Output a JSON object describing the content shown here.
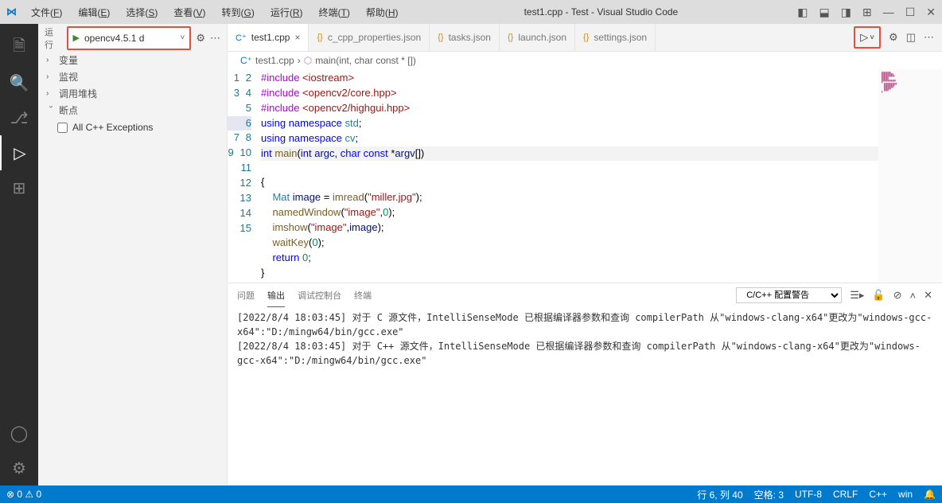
{
  "titlebar": {
    "menus": [
      {
        "label": "文件",
        "u": "F"
      },
      {
        "label": "编辑",
        "u": "E"
      },
      {
        "label": "选择",
        "u": "S"
      },
      {
        "label": "查看",
        "u": "V"
      },
      {
        "label": "转到",
        "u": "G"
      },
      {
        "label": "运行",
        "u": "R"
      },
      {
        "label": "终端",
        "u": "T"
      },
      {
        "label": "帮助",
        "u": "H"
      }
    ],
    "title": "test1.cpp - Test - Visual Studio Code"
  },
  "sidebar": {
    "run_label": "运行",
    "config_name": "opencv4.5.1 d",
    "sections": [
      {
        "label": "变量",
        "expanded": false
      },
      {
        "label": "监视",
        "expanded": false
      },
      {
        "label": "调用堆栈",
        "expanded": false
      },
      {
        "label": "断点",
        "expanded": true,
        "children": [
          {
            "label": "All C++ Exceptions",
            "checked": false
          }
        ]
      }
    ]
  },
  "tabs": [
    {
      "label": "test1.cpp",
      "icon": "cpp",
      "active": true,
      "closable": true
    },
    {
      "label": "c_cpp_properties.json",
      "icon": "json"
    },
    {
      "label": "tasks.json",
      "icon": "json"
    },
    {
      "label": "launch.json",
      "icon": "json"
    },
    {
      "label": "settings.json",
      "icon": "json"
    }
  ],
  "breadcrumb": {
    "file": "test1.cpp",
    "symbol": "main(int, char const * [])"
  },
  "code": {
    "lines": 15,
    "highlight_line": 6,
    "raw": [
      [
        {
          "t": "#include ",
          "c": "pre"
        },
        {
          "t": "<iostream>",
          "c": "inc"
        }
      ],
      [
        {
          "t": "#include ",
          "c": "pre"
        },
        {
          "t": "<opencv2/core.hpp>",
          "c": "inc"
        }
      ],
      [
        {
          "t": "#include ",
          "c": "pre"
        },
        {
          "t": "<opencv2/highgui.hpp>",
          "c": "inc"
        }
      ],
      [
        {
          "t": "using namespace ",
          "c": "kw"
        },
        {
          "t": "std",
          "c": "type"
        },
        {
          "t": ";",
          "c": ""
        }
      ],
      [
        {
          "t": "using namespace ",
          "c": "kw"
        },
        {
          "t": "cv",
          "c": "type"
        },
        {
          "t": ";",
          "c": ""
        }
      ],
      [
        {
          "t": "int ",
          "c": "kw"
        },
        {
          "t": "main",
          "c": "fn"
        },
        {
          "t": "(",
          "c": ""
        },
        {
          "t": "int ",
          "c": "kw"
        },
        {
          "t": "argc",
          "c": "var"
        },
        {
          "t": ", ",
          "c": ""
        },
        {
          "t": "char const ",
          "c": "kw"
        },
        {
          "t": "*",
          "c": ""
        },
        {
          "t": "argv",
          "c": "var"
        },
        {
          "t": "[])",
          "c": ""
        }
      ],
      [
        {
          "t": "{",
          "c": ""
        }
      ],
      [
        {
          "t": "    ",
          "c": ""
        },
        {
          "t": "Mat ",
          "c": "type"
        },
        {
          "t": "image",
          "c": "var"
        },
        {
          "t": " = ",
          "c": ""
        },
        {
          "t": "imread",
          "c": "fn"
        },
        {
          "t": "(",
          "c": ""
        },
        {
          "t": "\"miller.jpg\"",
          "c": "str"
        },
        {
          "t": ");",
          "c": ""
        }
      ],
      [
        {
          "t": "    ",
          "c": ""
        },
        {
          "t": "namedWindow",
          "c": "fn"
        },
        {
          "t": "(",
          "c": ""
        },
        {
          "t": "\"image\"",
          "c": "str"
        },
        {
          "t": ",",
          "c": ""
        },
        {
          "t": "0",
          "c": "num"
        },
        {
          "t": ");",
          "c": ""
        }
      ],
      [
        {
          "t": "    ",
          "c": ""
        },
        {
          "t": "imshow",
          "c": "fn"
        },
        {
          "t": "(",
          "c": ""
        },
        {
          "t": "\"image\"",
          "c": "str"
        },
        {
          "t": ",",
          "c": ""
        },
        {
          "t": "image",
          "c": "var"
        },
        {
          "t": ");",
          "c": ""
        }
      ],
      [
        {
          "t": "    ",
          "c": ""
        },
        {
          "t": "waitKey",
          "c": "fn"
        },
        {
          "t": "(",
          "c": ""
        },
        {
          "t": "0",
          "c": "num"
        },
        {
          "t": ");",
          "c": ""
        }
      ],
      [
        {
          "t": "    ",
          "c": ""
        },
        {
          "t": "return ",
          "c": "kw"
        },
        {
          "t": "0",
          "c": "num"
        },
        {
          "t": ";",
          "c": ""
        }
      ],
      [
        {
          "t": "}",
          "c": ""
        }
      ],
      [],
      []
    ]
  },
  "panel": {
    "tabs": [
      "问题",
      "输出",
      "调试控制台",
      "终端"
    ],
    "active_tab": "输出",
    "select_value": "C/C++ 配置警告",
    "content": "[2022/8/4 18:03:45] 对于 C 源文件，IntelliSenseMode 已根据编译器参数和查询 compilerPath 从\"windows-clang-x64\"更改为\"windows-gcc-x64\":\"D:/mingw64/bin/gcc.exe\"\n[2022/8/4 18:03:45] 对于 C++ 源文件，IntelliSenseMode 已根据编译器参数和查询 compilerPath 从\"windows-clang-x64\"更改为\"windows-gcc-x64\":\"D:/mingw64/bin/gcc.exe\""
  },
  "statusbar": {
    "errors": "0",
    "warnings": "0",
    "cursor": "行 6, 列 40",
    "spaces": "空格: 3",
    "encoding": "UTF-8",
    "eol": "CRLF",
    "lang": "C++",
    "win": "win"
  }
}
